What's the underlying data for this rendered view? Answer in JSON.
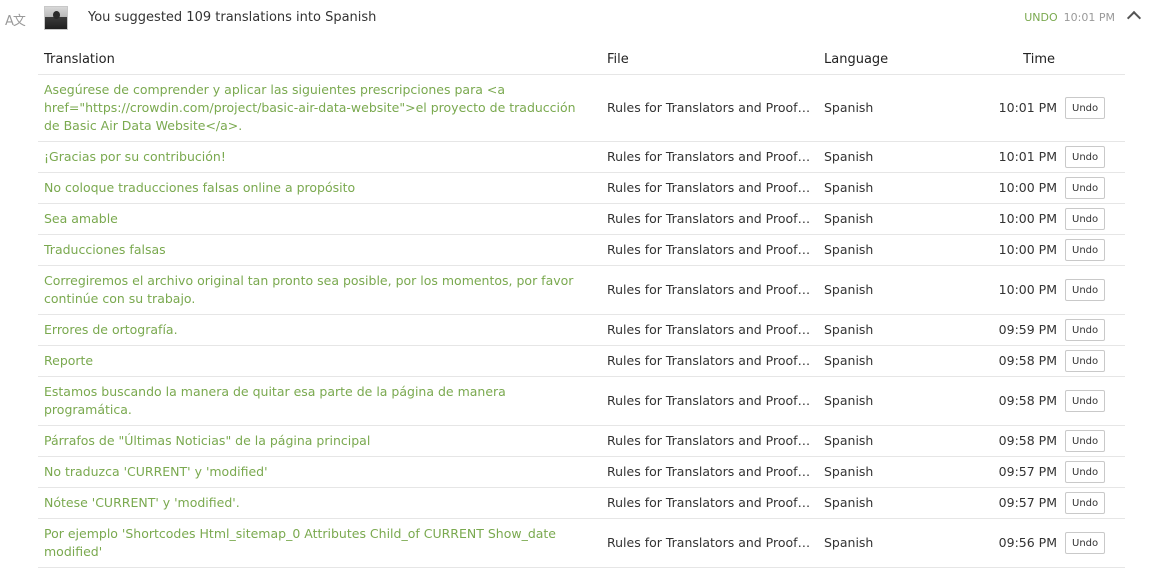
{
  "header": {
    "icon": "translate-icon",
    "summary": "You suggested 109 translations into Spanish",
    "undo_label": "UNDO",
    "time": "10:01 PM",
    "collapse_icon": "chevron-up-icon"
  },
  "table": {
    "columns": {
      "translation": "Translation",
      "file": "File",
      "language": "Language",
      "time": "Time"
    },
    "undo_button_label": "Undo",
    "rows": [
      {
        "translation": "Asegúrese de comprender y aplicar las siguientes prescripciones para <a href=\"https://crowdin.com/project/basic-air-data-website\">el proyecto de traducción de Basic Air Data Website</a>.",
        "file": "Rules for Translators and Proofreaders",
        "language": "Spanish",
        "time": "10:01 PM",
        "undo": "Undo"
      },
      {
        "translation": "¡Gracias por su contribución!",
        "file": "Rules for Translators and Proofreaders",
        "language": "Spanish",
        "time": "10:01 PM",
        "undo": "Undo"
      },
      {
        "translation": "No coloque traducciones falsas online a propósito",
        "file": "Rules for Translators and Proofreaders",
        "language": "Spanish",
        "time": "10:00 PM",
        "undo": "Undo"
      },
      {
        "translation": "Sea amable",
        "file": "Rules for Translators and Proofreaders",
        "language": "Spanish",
        "time": "10:00 PM",
        "undo": "Undo"
      },
      {
        "translation": "Traducciones falsas",
        "file": "Rules for Translators and Proofreaders",
        "language": "Spanish",
        "time": "10:00 PM",
        "undo": "Undo"
      },
      {
        "translation": "Corregiremos el archivo original tan pronto sea posible, por los momentos, por favor continúe con su trabajo.",
        "file": "Rules for Translators and Proofreaders",
        "language": "Spanish",
        "time": "10:00 PM",
        "undo": "Undo"
      },
      {
        "translation": "Errores de ortografía.",
        "file": "Rules for Translators and Proofreaders",
        "language": "Spanish",
        "time": "09:59 PM",
        "undo": "Undo"
      },
      {
        "translation": "Reporte",
        "file": "Rules for Translators and Proofreaders",
        "language": "Spanish",
        "time": "09:58 PM",
        "undo": "Undo"
      },
      {
        "translation": "Estamos buscando la manera de quitar esa parte de la página de manera programática.",
        "file": "Rules for Translators and Proofreaders",
        "language": "Spanish",
        "time": "09:58 PM",
        "undo": "Undo"
      },
      {
        "translation": "Párrafos de \"Últimas Noticias\" de la página principal",
        "file": "Rules for Translators and Proofreaders",
        "language": "Spanish",
        "time": "09:58 PM",
        "undo": "Undo"
      },
      {
        "translation": "No traduzca 'CURRENT' y 'modified'",
        "file": "Rules for Translators and Proofreaders",
        "language": "Spanish",
        "time": "09:57 PM",
        "undo": "Undo"
      },
      {
        "translation": "Nótese 'CURRENT' y 'modified'.",
        "file": "Rules for Translators and Proofreaders",
        "language": "Spanish",
        "time": "09:57 PM",
        "undo": "Undo"
      },
      {
        "translation": "Por ejemplo 'Shortcodes Html_sitemap_0 Attributes Child_of CURRENT Show_date modified'",
        "file": "Rules for Translators and Proofreaders",
        "language": "Spanish",
        "time": "09:56 PM",
        "undo": "Undo"
      }
    ]
  }
}
